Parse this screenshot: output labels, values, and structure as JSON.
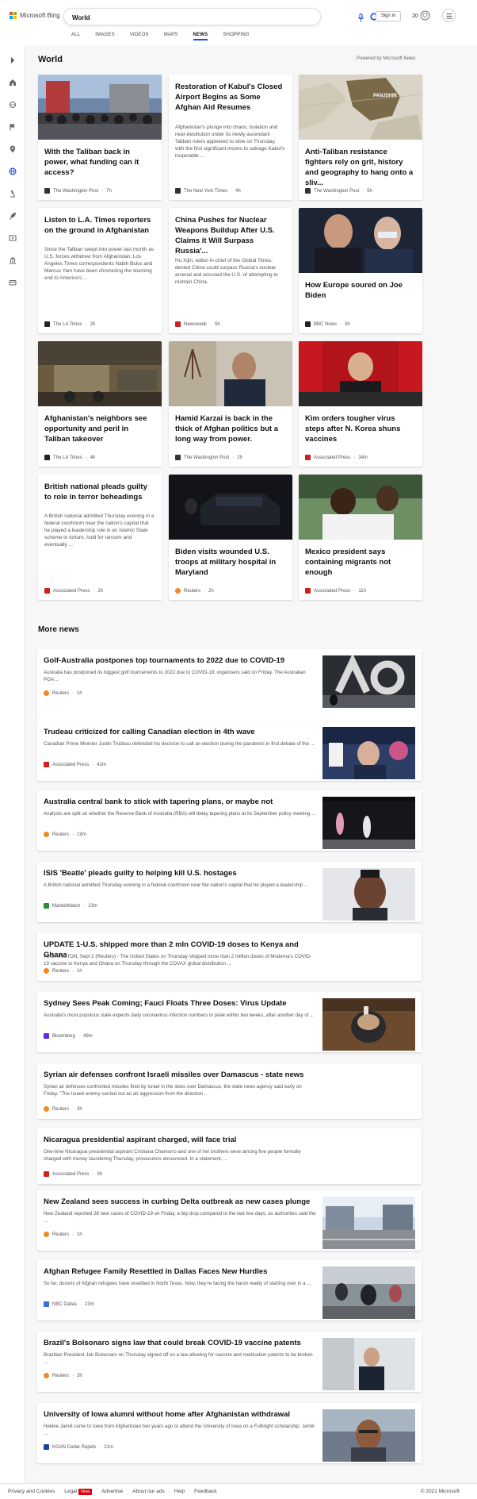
{
  "header": {
    "brand": "Microsoft Bing",
    "search_value": "World",
    "signin_label": "Sign in",
    "rewards_count": "20",
    "tabs": [
      {
        "label": "ALL",
        "active": false
      },
      {
        "label": "IMAGES",
        "active": false
      },
      {
        "label": "VIDEOS",
        "active": false
      },
      {
        "label": "MAPS",
        "active": false
      },
      {
        "label": "NEWS",
        "active": true
      },
      {
        "label": "SHOPPING",
        "active": false
      }
    ]
  },
  "sidebar": {
    "icons": [
      "chevron-right-icon",
      "home-icon",
      "sports-icon",
      "flag-icon",
      "location-pin-icon",
      "globe-icon",
      "microscope-icon",
      "rocket-icon",
      "film-icon",
      "bank-icon",
      "wallet-icon"
    ]
  },
  "section": {
    "title": "World",
    "powered_by": "Powered by Microsoft News"
  },
  "cards": [
    {
      "title": "With the Taliban back in power, what funding can it access?",
      "desc": "",
      "source": "The Washington Post",
      "age": "7h",
      "src_color": "#333"
    },
    {
      "title": "Restoration of Kabul's Closed Airport Begins as Some Afghan Aid Resumes",
      "desc": "Afghanistan's plunge into chaos, isolation and near-destitution under its newly ascendant Taliban rulers appeared to slow on Thursday, with the first significant moves to salvage Kabul's inoperable ...",
      "source": "The New York Times",
      "age": "4h",
      "src_color": "#333"
    },
    {
      "title": "Anti-Taliban resistance fighters rely on grit, history and geography to hang onto a sliv...",
      "desc": "",
      "source": "The Washington Post",
      "age": "5h",
      "src_color": "#333",
      "map_label": "PANJSHIR"
    },
    {
      "title": "Listen to L.A. Times reporters on the ground in Afghanistan",
      "desc": "Since the Taliban swept into power last month as U.S. forces withdrew from Afghanistan, Los Angeles Times correspondents Nabih Bulos and Marcus Yam have been chronicling the stunning end to America's ...",
      "source": "The LA Times",
      "age": "2h",
      "src_color": "#222"
    },
    {
      "title": "China Pushes for Nuclear Weapons Buildup After U.S. Claims it Will Surpass Russia'...",
      "desc": "Hu Xijin, editor-in-chief of the Global Times, denied China could surpass Russia's nuclear arsenal and accused the U.S. of attempting to restrain China.",
      "source": "Newsweek",
      "age": "5h",
      "src_color": "#d0201b"
    },
    {
      "title": "How Europe soured on Joe Biden",
      "desc": "",
      "source": "BBC News",
      "age": "3h",
      "src_color": "#222"
    },
    {
      "title": "Afghanistan's neighbors see opportunity and peril in Taliban takeover",
      "desc": "",
      "source": "The LA Times",
      "age": "4h",
      "src_color": "#222"
    },
    {
      "title": "Hamid Karzai is back in the thick of Afghan politics but a long way from power.",
      "desc": "",
      "source": "The Washington Post",
      "age": "2h",
      "src_color": "#333"
    },
    {
      "title": "Kim orders tougher virus steps after N. Korea shuns vaccines",
      "desc": "",
      "source": "Associated Press",
      "age": "34m",
      "src_color": "#d0201b"
    },
    {
      "title": "British national pleads guilty to role in terror beheadings",
      "desc": "A British national admitted Thursday evening in a federal courtroom near the nation's capital that he played a leadership role in an Islamic State scheme to torture, hold for ransom and eventually ...",
      "source": "Associated Press",
      "age": "2h",
      "src_color": "#d0201b"
    },
    {
      "title": "Biden visits wounded U.S. troops at military hospital in Maryland",
      "desc": "",
      "source": "Reuters",
      "age": "2h",
      "src_color": "#f08a24"
    },
    {
      "title": "Mexico president says containing migrants not enough",
      "desc": "",
      "source": "Associated Press",
      "age": "11h",
      "src_color": "#d0201b"
    }
  ],
  "more_news": {
    "title": "More news",
    "items": [
      {
        "title": "Golf-Australia postpones top tournaments to 2022 due to COVID-19",
        "desc": "Australia has postponed its biggest golf tournaments to 2022 due to COVID-19, organisers said on Friday. The Australian PGA ...",
        "source": "Reuters",
        "age": "1h",
        "src_color": "#f08a24",
        "has_thumb": true,
        "thumb_text": "AO"
      },
      {
        "title": "Trudeau criticized for calling Canadian election in 4th wave",
        "desc": "Canadian Prime Minister Justin Trudeau defended his decision to call an election during the pandemic in first debate of the ...",
        "source": "Associated Press",
        "age": "42m",
        "src_color": "#d0201b",
        "has_thumb": true
      },
      {
        "title": "Australia central bank to stick with tapering plans, or maybe not",
        "desc": "Analysts are split on whether the Reserve Bank of Australia (RBA) will delay tapering plans at its September policy meeting ...",
        "source": "Reuters",
        "age": "19m",
        "src_color": "#f08a24",
        "has_thumb": true,
        "thumb_text": "RESERVE BANK OF AUSTRALIA"
      },
      {
        "title": "ISIS 'Beatle' pleads guilty to helping kill U.S. hostages",
        "desc": "A British national admitted Thursday evening in a federal courtroom near the nation's capital that he played a leadership ...",
        "source": "MarketWatch",
        "age": "13m",
        "src_color": "#2c8c3c",
        "has_thumb": true
      },
      {
        "title": "UPDATE 1-U.S. shipped more than 2 mln COVID-19 doses to Kenya and Ghana",
        "desc": "WASHINGTON, Sept 2 (Reuters) - The United States on Thursday shipped more than 2 million doses of Moderna's COVID-19 vaccine to Kenya and Ghana on Thursday through the COVAX global distribution ...",
        "source": "Reuters",
        "age": "1h",
        "src_color": "#f08a24",
        "has_thumb": false
      },
      {
        "title": "Sydney Sees Peak Coming; Fauci Floats Three Doses: Virus Update",
        "desc": "Australia's most populous state expects daily coronavirus infection numbers to peak within two weeks, after another day of ...",
        "source": "Bloomberg",
        "age": "49m",
        "src_color": "#5b2ee0",
        "has_thumb": true
      },
      {
        "title": "Syrian air defenses confront Israeli missiles over Damascus - state news",
        "desc": "Syrian air defenses confronted missiles fired by Israel in the skies over Damascus, the state news agency said early on Friday. \"The Israeli enemy carried out an air aggression from the direction ...",
        "source": "Reuters",
        "age": "3h",
        "src_color": "#f08a24",
        "has_thumb": false
      },
      {
        "title": "Nicaragua presidential aspirant charged, will face trial",
        "desc": "One-time Nicaragua presidential aspirant Cristiana Chamorro and one of her brothers were among five people formally charged with money laundering Thursday, prosecutors announced. In a statement, ...",
        "source": "Associated Press",
        "age": "3h",
        "src_color": "#d0201b",
        "has_thumb": false
      },
      {
        "title": "New Zealand sees success in curbing Delta outbreak as new cases plunge",
        "desc": "New Zealand reported 28 new cases of COVID-19 on Friday, a big drop compared to the last few days, as authorities said the ...",
        "source": "Reuters",
        "age": "1h",
        "src_color": "#f08a24",
        "has_thumb": true
      },
      {
        "title": "Afghan Refugee Family Resettled in Dallas Faces New Hurdles",
        "desc": "So far, dozens of Afghan refugees have resettled in North Texas. Now, they're facing the harsh reality of starting over in a ...",
        "source": "NBC Dallas",
        "age": "23m",
        "src_color": "#3a6fd8",
        "has_thumb": true
      },
      {
        "title": "Brazil's Bolsonaro signs law that could break COVID-19 vaccine patents",
        "desc": "Brazilian President Jair Bolsonaro on Thursday signed off on a law allowing for vaccine and medication patents to be broken ...",
        "source": "Reuters",
        "age": "3h",
        "src_color": "#f08a24",
        "has_thumb": true
      },
      {
        "title": "University of Iowa alumni without home after Afghanistan withdrawal",
        "desc": "Hekkie Jamili came to Iowa from Afghanistan two years ago to attend the University of Iowa on a Fulbright scholarship. Jamili ...",
        "source": "KGAN Cedar Rapids",
        "age": "21m",
        "src_color": "#1c3f9c",
        "has_thumb": true
      }
    ]
  },
  "footer": {
    "links": [
      "Privacy and Cookies",
      "Legal",
      "Advertise",
      "About our ads",
      "Help",
      "Feedback"
    ],
    "new_badge": "New",
    "copyright": "© 2021 Microsoft"
  },
  "colors": {
    "accent": "#174ae4",
    "ms_red": "#f25022",
    "ms_green": "#7fba00",
    "ms_blue": "#00a4ef",
    "ms_yellow": "#ffb900"
  }
}
